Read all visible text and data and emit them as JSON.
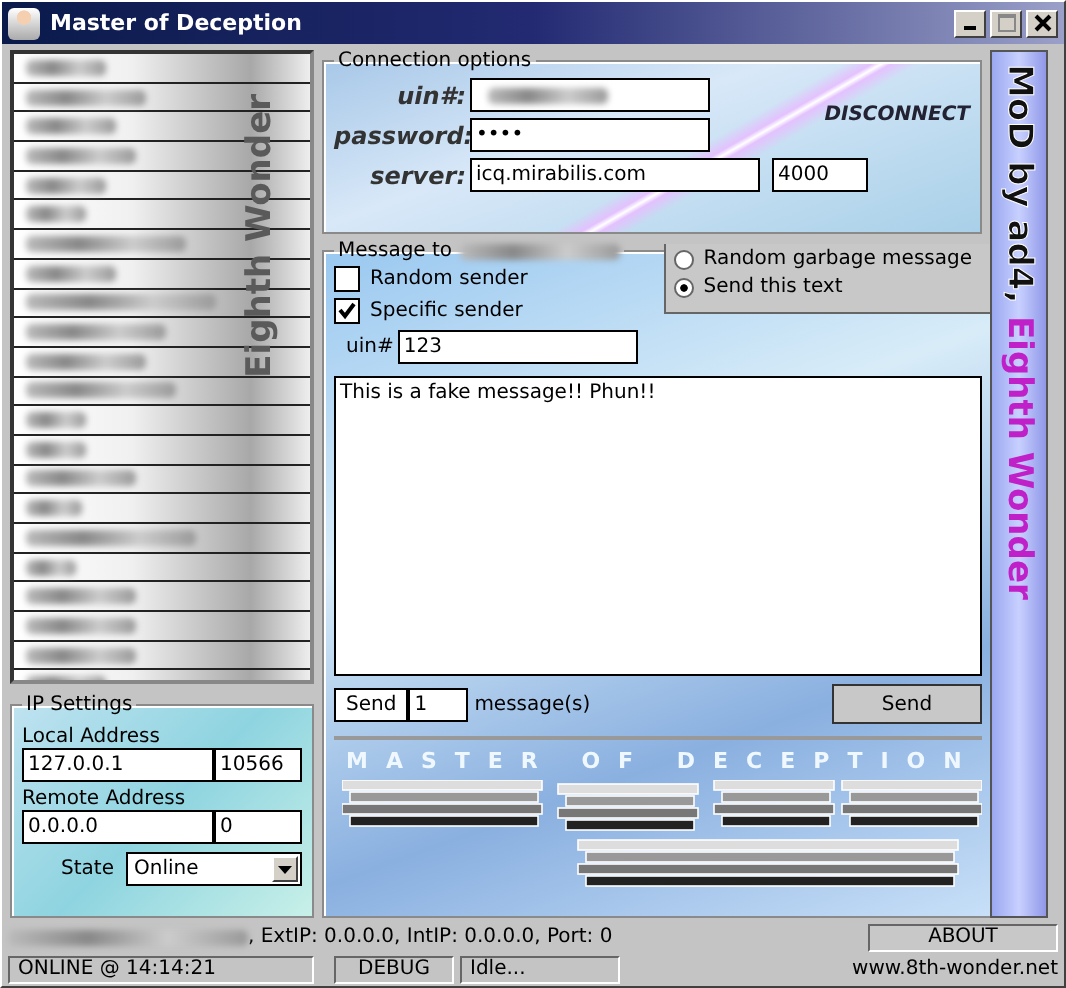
{
  "window": {
    "title": "Master of Deception"
  },
  "contact_list": {
    "watermark": "Eighth Wonder"
  },
  "connection": {
    "title": "Connection options",
    "uin_label": "uin#:",
    "password_label": "password:",
    "password_value": "••••",
    "server_label": "server:",
    "server_value": "icq.mirabilis.com",
    "port_value": "4000",
    "disconnect": "DISCONNECT"
  },
  "message": {
    "title": "Message to",
    "senders": [
      {
        "label": "Random sender",
        "checked": false
      },
      {
        "label": "Specific sender",
        "checked": true
      }
    ],
    "uin_label": "uin#",
    "uin_value": "123",
    "modes": [
      {
        "label": "Random garbage message",
        "selected": false
      },
      {
        "label": "Send this text",
        "selected": true
      }
    ],
    "text": "This is a fake message!! Phun!!",
    "send_label": "Send",
    "count": "1",
    "count_suffix": "message(s)",
    "send_button": "Send"
  },
  "ip_settings": {
    "title": "IP Settings",
    "local_label": "Local Address",
    "local_ip": "127.0.0.1",
    "local_port": "10566",
    "remote_label": "Remote Address",
    "remote_ip": "0.0.0.0",
    "remote_port": "0",
    "state_label": "State",
    "state_value": "Online"
  },
  "banner": {
    "tagline": "MASTER OF DECEPTION",
    "side_text_1": "MoD by ad4,",
    "side_text_2": "Eighth Wonder"
  },
  "status_bar": {
    "info": ", ExtIP: 0.0.0.0, IntIP: 0.0.0.0, Port: 0",
    "about": "ABOUT",
    "online": "ONLINE @ 14:14:21",
    "debug": "DEBUG",
    "activity": "Idle...",
    "website": "www.8th-wonder.net"
  }
}
